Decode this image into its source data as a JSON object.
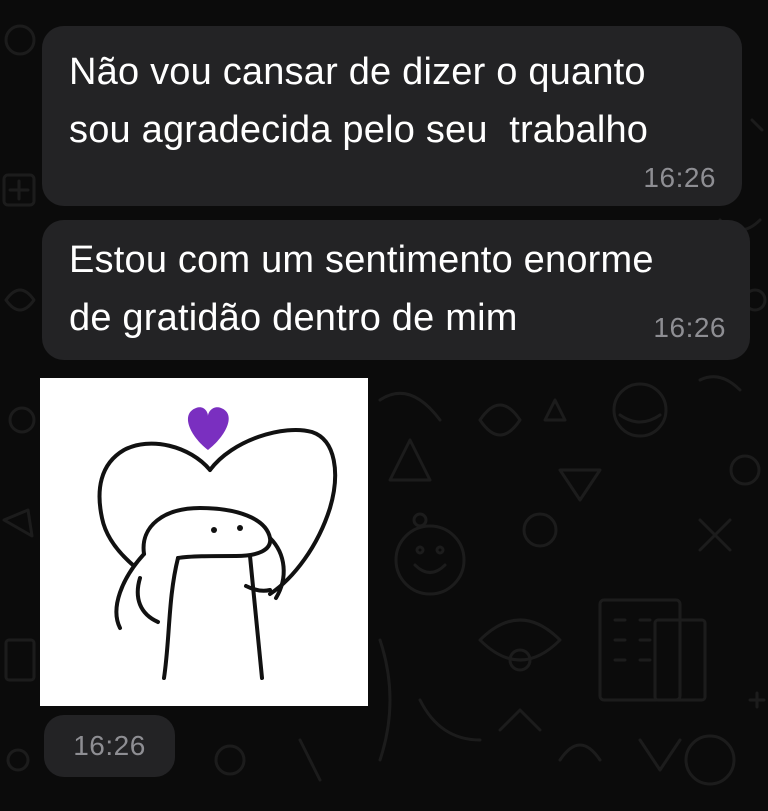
{
  "chat": {
    "messages": [
      {
        "text": "Não vou cansar de dizer o quanto\nsou agradecida pelo seu  trabalho",
        "time": "16:26"
      },
      {
        "text": "Estou com um sentimento enorme\nde gratidão dentro de mim",
        "time": "16:26"
      }
    ],
    "sticker": {
      "description_icon": "hug-heart-sticker",
      "time": "16:26",
      "heart_color": "#7a2fc0"
    }
  },
  "colors": {
    "background": "#0b0b0b",
    "bubble": "#232325",
    "text": "#ffffff",
    "timestamp": "#8e8e93"
  }
}
